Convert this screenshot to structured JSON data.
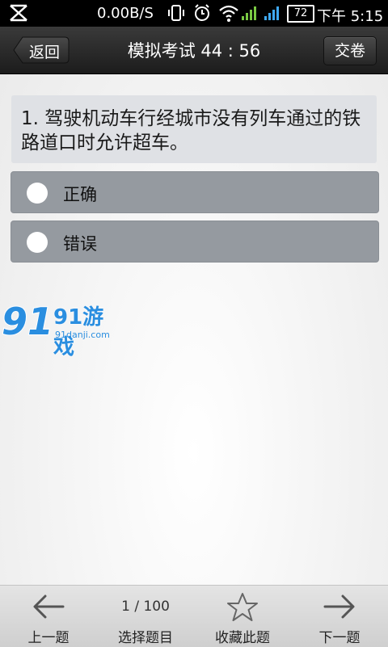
{
  "status_bar": {
    "network_speed": "0.00B/S",
    "battery": "72",
    "time": "下午 5:15"
  },
  "header": {
    "back_label": "返回",
    "title": "模拟考试 44 : 56",
    "submit_label": "交卷"
  },
  "question": {
    "text": "1. 驾驶机动车行经城市没有列车通过的铁路道口时允许超车。",
    "options": [
      {
        "label": "正确"
      },
      {
        "label": "错误"
      }
    ]
  },
  "watermark": {
    "logo_text": "91游戏",
    "domain": "91danji.com"
  },
  "bottom_nav": {
    "prev_label": "上一题",
    "counter": "1 / 100",
    "select_label": "选择题目",
    "favorite_label": "收藏此题",
    "next_label": "下一题"
  },
  "colors": {
    "option_bg": "#959aa0",
    "question_bg": "#dfe1e5",
    "header_bg": "#262626",
    "watermark_blue": "#2a8ee0"
  }
}
